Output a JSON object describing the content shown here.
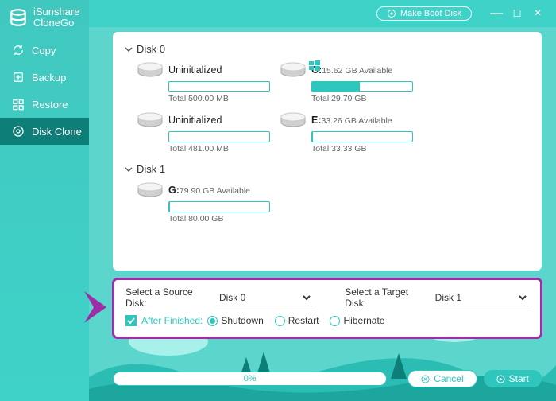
{
  "app": {
    "name1": "iSunshare",
    "name2": "CloneGo"
  },
  "topbar": {
    "makeBoot": "Make Boot Disk"
  },
  "nav": [
    {
      "key": "copy",
      "label": "Copy"
    },
    {
      "key": "backup",
      "label": "Backup"
    },
    {
      "key": "restore",
      "label": "Restore"
    },
    {
      "key": "diskclone",
      "label": "Disk Clone",
      "selected": true
    }
  ],
  "disks": [
    {
      "name": "Disk 0",
      "volumes": [
        {
          "kind": "uninit",
          "title": "Uninitialized",
          "total": "Total 500.00 MB",
          "fill": 0
        },
        {
          "kind": "win",
          "letter": "C:",
          "avail": "15.62 GB Available",
          "total": "Total 29.70 GB",
          "fill": 48
        },
        {
          "kind": "uninit",
          "title": "Uninitialized",
          "total": "Total 481.00 MB",
          "fill": 0
        },
        {
          "kind": "vol",
          "letter": "E:",
          "avail": "33.26 GB Available",
          "total": "Total 33.33 GB",
          "fill": 1
        }
      ]
    },
    {
      "name": "Disk 1",
      "volumes": [
        {
          "kind": "vol",
          "letter": "G:",
          "avail": "79.90 GB Available",
          "total": "Total 80.00 GB",
          "fill": 1
        }
      ]
    }
  ],
  "opts": {
    "srcLabel": "Select a Source Disk:",
    "srcValue": "Disk 0",
    "tgtLabel": "Select a Target Disk:",
    "tgtValue": "Disk 1",
    "afterLabel": "After Finished:",
    "radios": [
      {
        "label": "Shutdown",
        "on": true
      },
      {
        "label": "Restart",
        "on": false
      },
      {
        "label": "Hibernate",
        "on": false
      }
    ]
  },
  "bottom": {
    "progress": "0%",
    "cancel": "Cancel",
    "start": "Start"
  }
}
